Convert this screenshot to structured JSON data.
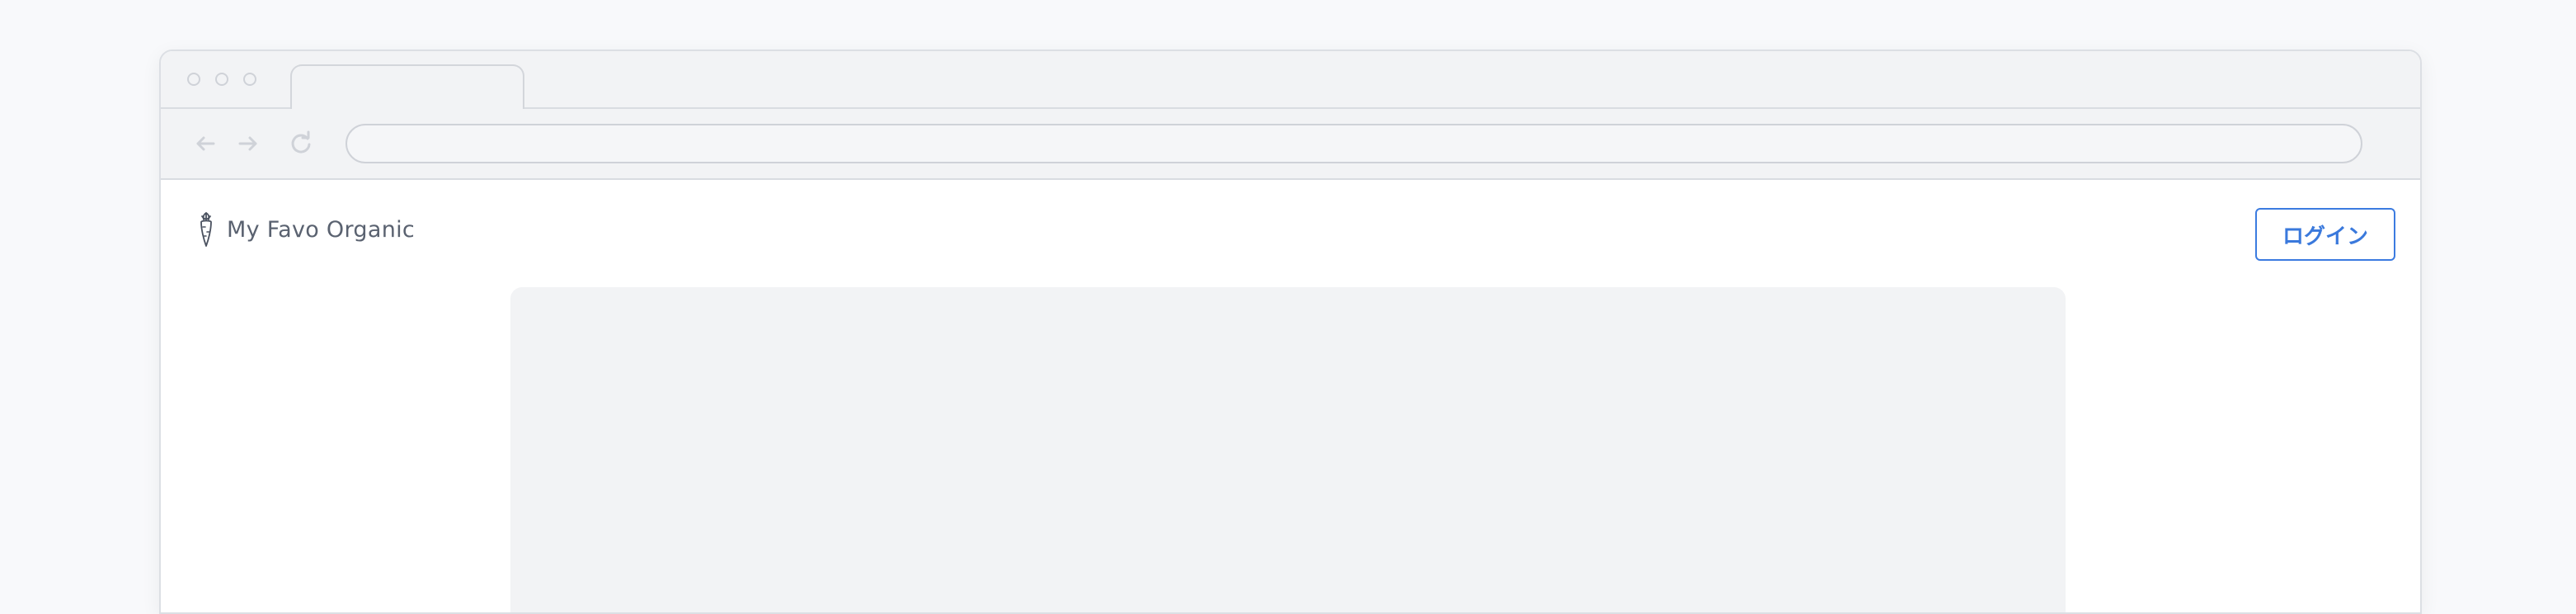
{
  "browser": {
    "tab_title": "",
    "address": "",
    "icons": {
      "back": "arrow-left-icon",
      "forward": "arrow-right-icon",
      "reload": "reload-icon"
    }
  },
  "header": {
    "brand_name": "My Favo Organic",
    "brand_icon": "carrot-icon",
    "login_label": "ログイン"
  },
  "colors": {
    "accent": "#3b7be0",
    "brand_text": "#5a6270",
    "placeholder_block": "#f2f3f5"
  }
}
